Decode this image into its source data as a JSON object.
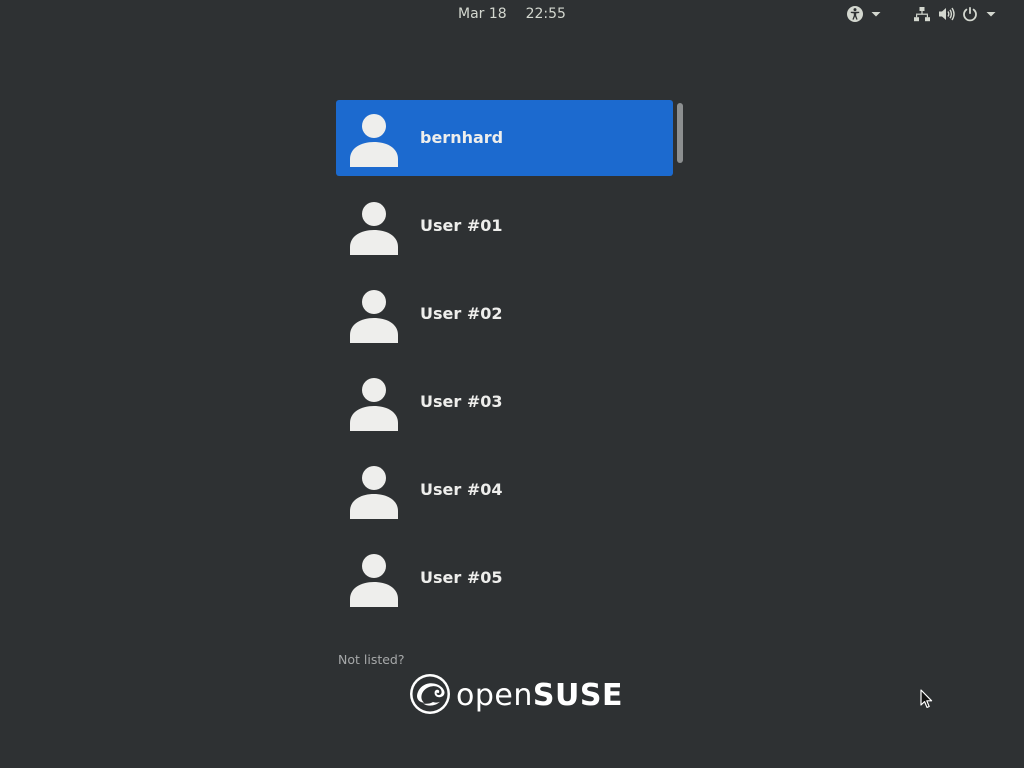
{
  "topbar": {
    "date": "Mar 18",
    "time": "22:55",
    "icons": {
      "accessibility": "accessibility-icon",
      "network": "network-wired-icon",
      "volume": "volume-icon",
      "power": "power-icon",
      "menu": "chevron-down-icon"
    }
  },
  "users": [
    {
      "name": "bernhard",
      "selected": true
    },
    {
      "name": "User #01",
      "selected": false
    },
    {
      "name": "User #02",
      "selected": false
    },
    {
      "name": "User #03",
      "selected": false
    },
    {
      "name": "User #04",
      "selected": false
    },
    {
      "name": "User #05",
      "selected": false
    }
  ],
  "not_listed_label": "Not listed?",
  "branding": {
    "logo": "opensuse-logo",
    "text_light": "open",
    "text_bold": "SUSE"
  },
  "colors": {
    "background": "#2e3133",
    "selected": "#1c6acf",
    "text": "#eeeeec"
  }
}
